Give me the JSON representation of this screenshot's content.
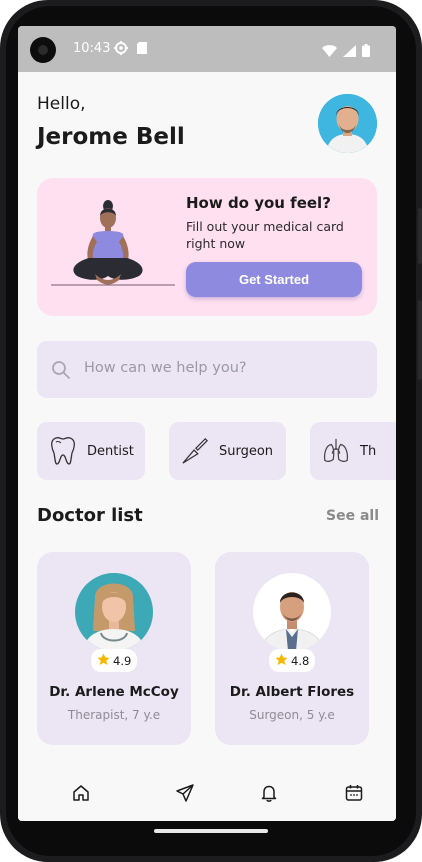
{
  "status_bar": {
    "time": "10:43",
    "left_icons": [
      "gear-icon",
      "sd-card-icon"
    ],
    "right_icons": [
      "wifi-icon",
      "signal-icon",
      "battery-icon"
    ]
  },
  "header": {
    "greeting": "Hello,",
    "user_name": "Jerome Bell",
    "avatar_icon": "user-avatar"
  },
  "promo": {
    "title": "How do you feel?",
    "subtitle": "Fill out your medical card right now",
    "button_label": "Get Started",
    "illustration": "meditating-woman-illustration"
  },
  "search": {
    "placeholder": "How can we help you?",
    "icon": "search-icon"
  },
  "categories": [
    {
      "label": "Dentist",
      "icon": "tooth-icon"
    },
    {
      "label": "Surgeon",
      "icon": "scalpel-icon"
    },
    {
      "label": "Th",
      "icon": "lungs-icon"
    }
  ],
  "doctor_section": {
    "title": "Doctor list",
    "see_all_label": "See all"
  },
  "doctors": [
    {
      "name": "Dr. Arlene McCoy",
      "role": "Therapist, 7 y.e",
      "rating": "4.9"
    },
    {
      "name": "Dr. Albert Flores",
      "role": "Surgeon, 5 y.e",
      "rating": "4.8"
    }
  ],
  "bottom_nav": [
    {
      "icon": "home-icon"
    },
    {
      "icon": "send-icon"
    },
    {
      "icon": "bell-icon"
    },
    {
      "icon": "calendar-icon"
    }
  ],
  "colors": {
    "accent": "#8d8ae0",
    "promo_bg": "#ffe0f0",
    "card_bg": "#ebe5f4",
    "star": "#f5b800",
    "text_primary": "#1b1b1b",
    "text_muted": "#8e8b96"
  }
}
